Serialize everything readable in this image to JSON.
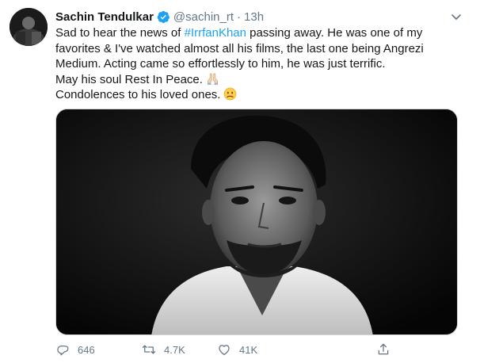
{
  "tweet": {
    "author_name": "Sachin Tendulkar",
    "handle": "@sachin_rt",
    "separator": "·",
    "time": "13h",
    "lines": [
      {
        "pre": "Sad to hear the news of ",
        "hashtag": "#IrrfanKhan",
        "post": " passing away. He was one of my"
      },
      {
        "text": "favorites & I've watched almost all his films, the last one being Angrezi"
      },
      {
        "text": "Medium. Acting came so effortlessly to him, he was just terrific."
      },
      {
        "text": "May his soul Rest In Peace."
      },
      {
        "text": "Condolences to his loved ones."
      }
    ]
  },
  "actions": {
    "reply_count": "646",
    "retweet_count": "4.7K",
    "like_count": "41K"
  },
  "icons": {
    "verified": "verified-badge-icon",
    "caret": "chevron-down-icon",
    "reply": "reply-icon",
    "retweet": "retweet-icon",
    "like": "heart-icon",
    "share": "share-icon",
    "pray_emoji": "folded-hands-emoji",
    "sad_emoji": "frowning-face-emoji"
  },
  "colors": {
    "text": "#14171a",
    "secondary": "#657786",
    "link": "#1da1f2",
    "verified": "#1da1f2"
  }
}
